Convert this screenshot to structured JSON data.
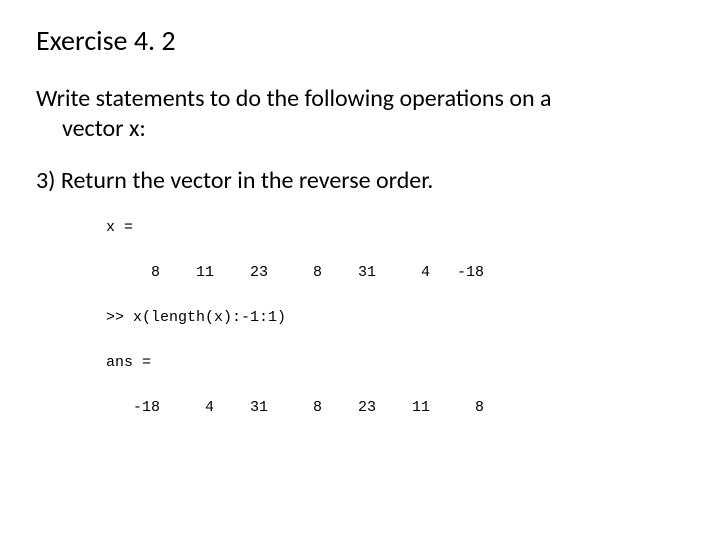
{
  "title": "Exercise 4. 2",
  "prompt_line1": "Write statements to do the following operations on a",
  "prompt_line2": "vector x:",
  "question": "3) Return the vector in the reverse order.",
  "code": "x =\n\n     8    11    23     8    31     4   -18\n\n>> x(length(x):-1:1)\n\nans =\n\n   -18     4    31     8    23    11     8"
}
